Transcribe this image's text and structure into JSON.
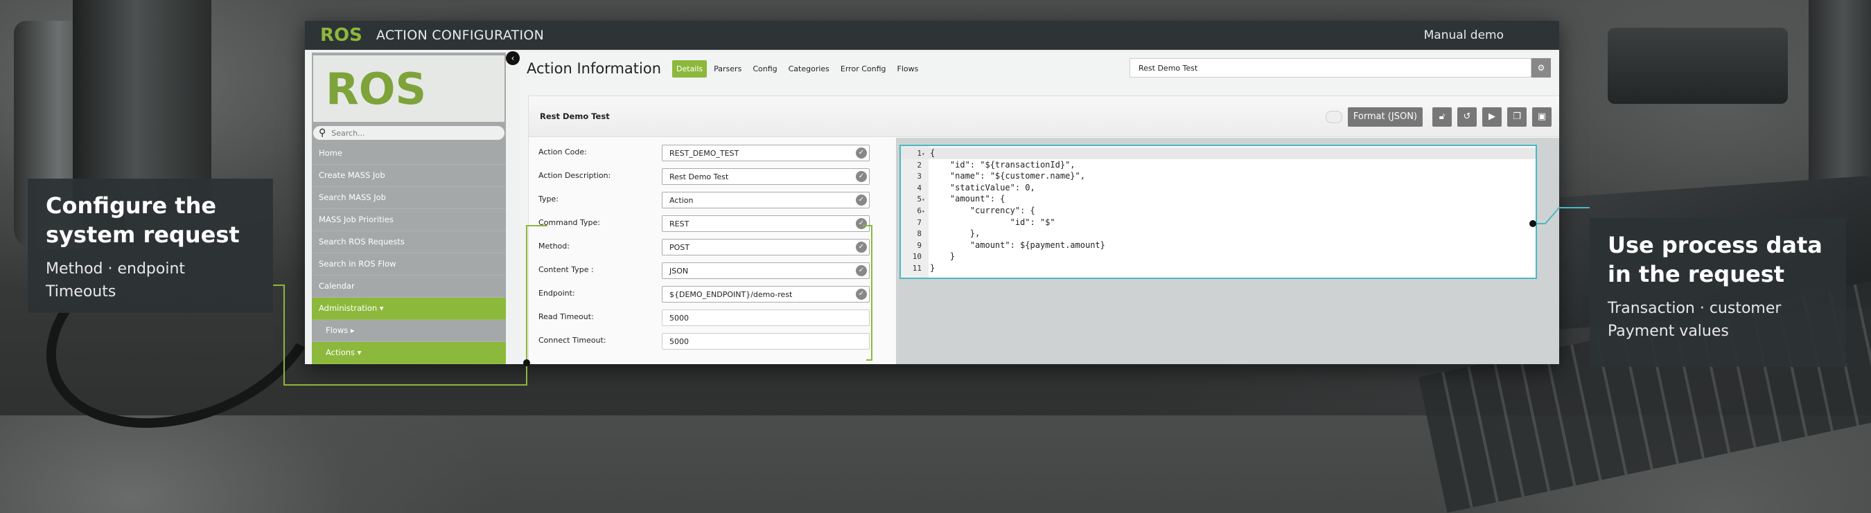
{
  "window": {
    "brand": "ROS",
    "subtitle": "ACTION CONFIGURATION",
    "mode": "Manual demo"
  },
  "sidebar": {
    "logo": "ROS",
    "search_placeholder": "Search...",
    "items": [
      {
        "label": "Home"
      },
      {
        "label": "Create MASS Job"
      },
      {
        "label": "Search MASS Job"
      },
      {
        "label": "MASS Job Priorities"
      },
      {
        "label": "Search ROS Requests"
      },
      {
        "label": "Search in ROS Flow"
      },
      {
        "label": "Calendar"
      },
      {
        "label": "Administration ▾"
      },
      {
        "label": "Flows ▸"
      },
      {
        "label": "Actions ▾"
      }
    ]
  },
  "content": {
    "title": "Action Information",
    "tabs": [
      "Details",
      "Parsers",
      "Config",
      "Categories",
      "Error Config",
      "Flows"
    ],
    "active_tab": "Details",
    "name_value": "Rest Demo Test"
  },
  "panel": {
    "title": "Rest Demo Test",
    "format_button": "Format (JSON)"
  },
  "form": [
    {
      "label": "Action Code:",
      "value": "REST_DEMO_TEST",
      "check": true
    },
    {
      "label": "Action Description:",
      "value": "Rest Demo Test",
      "check": true
    },
    {
      "label": "Type:",
      "value": "Action",
      "check": true
    },
    {
      "label": "Command Type:",
      "value": "REST",
      "check": true
    },
    {
      "label": "Method:",
      "value": "POST",
      "check": true
    },
    {
      "label": "Content Type :",
      "value": "JSON",
      "check": true
    },
    {
      "label": "Endpoint:",
      "value": "${DEMO_ENDPOINT}/demo-rest",
      "check": true
    },
    {
      "label": "Read Timeout:",
      "value": "5000",
      "check": false
    },
    {
      "label": "Connect Timeout:",
      "value": "5000",
      "check": false
    }
  ],
  "code": [
    {
      "n": "1",
      "fold": "▾",
      "text": "{"
    },
    {
      "n": "2",
      "fold": "",
      "text": "    \"id\": \"${transactionId}\","
    },
    {
      "n": "3",
      "fold": "",
      "text": "    \"name\": \"${customer.name}\","
    },
    {
      "n": "4",
      "fold": "",
      "text": "    \"staticValue\": 0,"
    },
    {
      "n": "5",
      "fold": "▾",
      "text": "    \"amount\": {"
    },
    {
      "n": "6",
      "fold": "▾",
      "text": "        \"currency\": {"
    },
    {
      "n": "7",
      "fold": "",
      "text": "                \"id\": \"$\""
    },
    {
      "n": "8",
      "fold": "",
      "text": "        },"
    },
    {
      "n": "9",
      "fold": "",
      "text": "        \"amount\": ${payment.amount}"
    },
    {
      "n": "10",
      "fold": "",
      "text": "    }"
    },
    {
      "n": "11",
      "fold": "",
      "text": "}"
    }
  ],
  "callouts": {
    "left": {
      "title_line1": "Configure the",
      "title_line2": "system request",
      "desc_line1": "Method · endpoint",
      "desc_line2": "Timeouts"
    },
    "right": {
      "title_line1": "Use process data",
      "title_line2": "in the request",
      "desc_line1": "Transaction · customer",
      "desc_line2": "Payment values"
    }
  },
  "colors": {
    "accent_green": "#8cb83c",
    "accent_cyan": "#4bb7c4",
    "titlebar": "#2e3336"
  }
}
